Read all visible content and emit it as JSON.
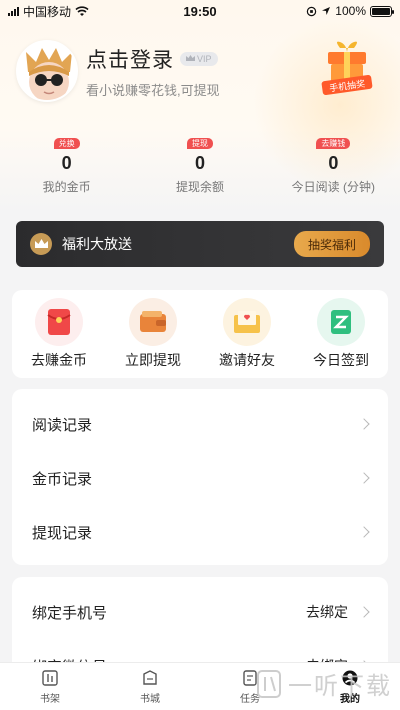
{
  "status_bar": {
    "carrier": "中国移动",
    "time": "19:50",
    "battery": "100%"
  },
  "profile": {
    "title": "点击登录",
    "vip": "VIP",
    "subtitle": "看小说赚零花钱,可提现",
    "lottery_text": "手机抽奖"
  },
  "stats": [
    {
      "tag": "兑换",
      "value": "0",
      "label": "我的金币"
    },
    {
      "tag": "提现",
      "value": "0",
      "label": "提现余额"
    },
    {
      "tag": "去赚钱",
      "value": "0",
      "label": "今日阅读 (分钟)"
    }
  ],
  "welfare": {
    "title": "福利大放送",
    "button": "抽奖福利"
  },
  "actions": [
    {
      "label": "去赚金币",
      "icon": "red-envelope-icon"
    },
    {
      "label": "立即提现",
      "icon": "wallet-icon"
    },
    {
      "label": "邀请好友",
      "icon": "invite-envelope-icon"
    },
    {
      "label": "今日签到",
      "icon": "sign-in-icon"
    }
  ],
  "records": [
    {
      "label": "阅读记录"
    },
    {
      "label": "金币记录"
    },
    {
      "label": "提现记录"
    }
  ],
  "account": [
    {
      "label": "绑定手机号",
      "value": "去绑定"
    },
    {
      "label": "绑定微信号",
      "value": "去绑定"
    }
  ],
  "tabs": [
    {
      "label": "书架",
      "icon": "bookshelf-icon"
    },
    {
      "label": "书城",
      "icon": "bookstore-icon"
    },
    {
      "label": "任务",
      "icon": "task-icon"
    },
    {
      "label": "我的",
      "icon": "profile-icon"
    }
  ],
  "watermark": "一听下载",
  "colors": {
    "tag_red": "#f05050",
    "gold": "#d98a2c",
    "banner_dark": "#2b2b2d"
  }
}
